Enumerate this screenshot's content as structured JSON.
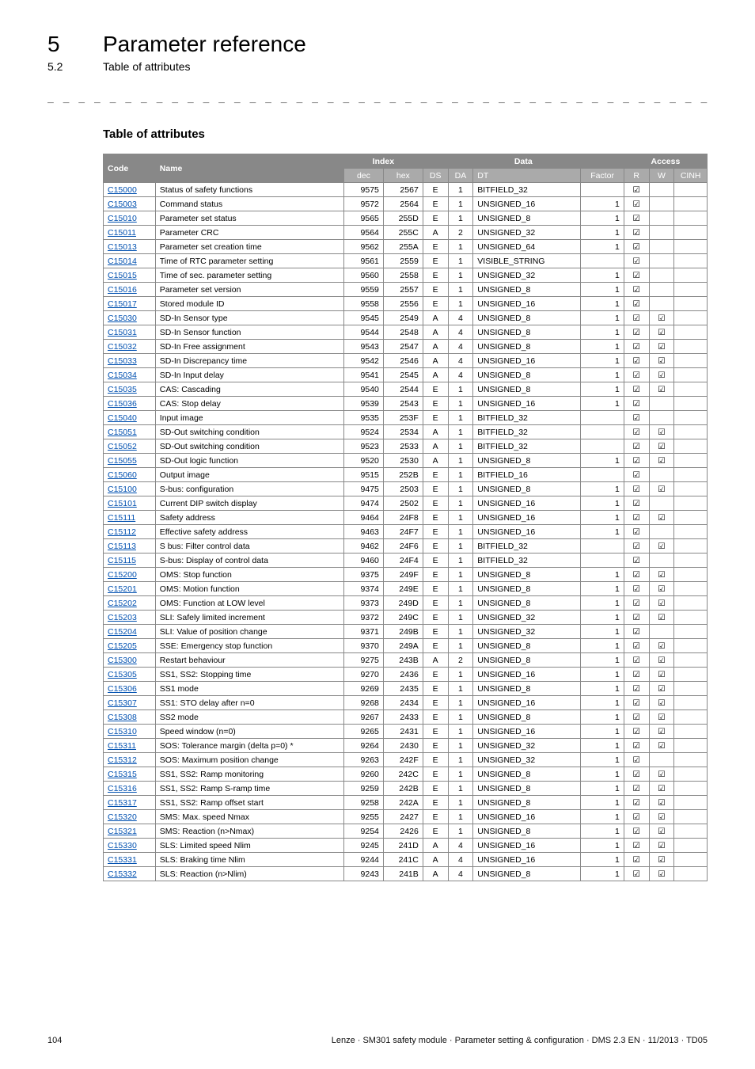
{
  "header": {
    "num": "5",
    "title": "Parameter reference",
    "sub_num": "5.2",
    "sub_title": "Table of attributes"
  },
  "dashes": "_ _ _ _ _ _ _ _ _ _ _ _ _ _ _ _ _ _ _ _ _ _ _ _ _ _ _ _ _ _ _ _ _ _ _ _ _ _ _ _ _ _ _ _ _ _ _ _ _ _ _ _ _ _ _ _ _ _ _ _ _ _ _",
  "section_title": "Table of attributes",
  "table": {
    "headers1": {
      "code": "Code",
      "name": "Name",
      "index": "Index",
      "data": "Data",
      "access": "Access"
    },
    "headers2": {
      "dec": "dec",
      "hex": "hex",
      "ds": "DS",
      "da": "DA",
      "dt": "DT",
      "factor": "Factor",
      "r": "R",
      "w": "W",
      "cinh": "CINH"
    },
    "rows": [
      {
        "code": "C15000",
        "name": "Status of safety functions",
        "dec": "9575",
        "hex": "2567",
        "ds": "E",
        "da": "1",
        "dt": "BITFIELD_32",
        "factor": "",
        "r": true,
        "w": false,
        "cinh": false
      },
      {
        "code": "C15003",
        "name": "Command status",
        "dec": "9572",
        "hex": "2564",
        "ds": "E",
        "da": "1",
        "dt": "UNSIGNED_16",
        "factor": "1",
        "r": true,
        "w": false,
        "cinh": false
      },
      {
        "code": "C15010",
        "name": "Parameter set status",
        "dec": "9565",
        "hex": "255D",
        "ds": "E",
        "da": "1",
        "dt": "UNSIGNED_8",
        "factor": "1",
        "r": true,
        "w": false,
        "cinh": false
      },
      {
        "code": "C15011",
        "name": "Parameter CRC",
        "dec": "9564",
        "hex": "255C",
        "ds": "A",
        "da": "2",
        "dt": "UNSIGNED_32",
        "factor": "1",
        "r": true,
        "w": false,
        "cinh": false
      },
      {
        "code": "C15013",
        "name": "Parameter set creation time",
        "dec": "9562",
        "hex": "255A",
        "ds": "E",
        "da": "1",
        "dt": "UNSIGNED_64",
        "factor": "1",
        "r": true,
        "w": false,
        "cinh": false
      },
      {
        "code": "C15014",
        "name": "Time of RTC parameter setting",
        "dec": "9561",
        "hex": "2559",
        "ds": "E",
        "da": "1",
        "dt": "VISIBLE_STRING",
        "factor": "",
        "r": true,
        "w": false,
        "cinh": false
      },
      {
        "code": "C15015",
        "name": "Time of sec. parameter setting",
        "dec": "9560",
        "hex": "2558",
        "ds": "E",
        "da": "1",
        "dt": "UNSIGNED_32",
        "factor": "1",
        "r": true,
        "w": false,
        "cinh": false
      },
      {
        "code": "C15016",
        "name": "Parameter set version",
        "dec": "9559",
        "hex": "2557",
        "ds": "E",
        "da": "1",
        "dt": "UNSIGNED_8",
        "factor": "1",
        "r": true,
        "w": false,
        "cinh": false
      },
      {
        "code": "C15017",
        "name": "Stored module ID",
        "dec": "9558",
        "hex": "2556",
        "ds": "E",
        "da": "1",
        "dt": "UNSIGNED_16",
        "factor": "1",
        "r": true,
        "w": false,
        "cinh": false
      },
      {
        "code": "C15030",
        "name": "SD-In Sensor type",
        "dec": "9545",
        "hex": "2549",
        "ds": "A",
        "da": "4",
        "dt": "UNSIGNED_8",
        "factor": "1",
        "r": true,
        "w": true,
        "cinh": false
      },
      {
        "code": "C15031",
        "name": "SD-In Sensor function",
        "dec": "9544",
        "hex": "2548",
        "ds": "A",
        "da": "4",
        "dt": "UNSIGNED_8",
        "factor": "1",
        "r": true,
        "w": true,
        "cinh": false
      },
      {
        "code": "C15032",
        "name": "SD-In Free assignment",
        "dec": "9543",
        "hex": "2547",
        "ds": "A",
        "da": "4",
        "dt": "UNSIGNED_8",
        "factor": "1",
        "r": true,
        "w": true,
        "cinh": false
      },
      {
        "code": "C15033",
        "name": "SD-In Discrepancy time",
        "dec": "9542",
        "hex": "2546",
        "ds": "A",
        "da": "4",
        "dt": "UNSIGNED_16",
        "factor": "1",
        "r": true,
        "w": true,
        "cinh": false
      },
      {
        "code": "C15034",
        "name": "SD-In Input delay",
        "dec": "9541",
        "hex": "2545",
        "ds": "A",
        "da": "4",
        "dt": "UNSIGNED_8",
        "factor": "1",
        "r": true,
        "w": true,
        "cinh": false
      },
      {
        "code": "C15035",
        "name": "CAS: Cascading",
        "dec": "9540",
        "hex": "2544",
        "ds": "E",
        "da": "1",
        "dt": "UNSIGNED_8",
        "factor": "1",
        "r": true,
        "w": true,
        "cinh": false
      },
      {
        "code": "C15036",
        "name": "CAS: Stop delay",
        "dec": "9539",
        "hex": "2543",
        "ds": "E",
        "da": "1",
        "dt": "UNSIGNED_16",
        "factor": "1",
        "r": true,
        "w": false,
        "cinh": false
      },
      {
        "code": "C15040",
        "name": "Input image",
        "dec": "9535",
        "hex": "253F",
        "ds": "E",
        "da": "1",
        "dt": "BITFIELD_32",
        "factor": "",
        "r": true,
        "w": false,
        "cinh": false
      },
      {
        "code": "C15051",
        "name": "SD-Out switching condition",
        "dec": "9524",
        "hex": "2534",
        "ds": "A",
        "da": "1",
        "dt": "BITFIELD_32",
        "factor": "",
        "r": true,
        "w": true,
        "cinh": false
      },
      {
        "code": "C15052",
        "name": "SD-Out switching condition",
        "dec": "9523",
        "hex": "2533",
        "ds": "A",
        "da": "1",
        "dt": "BITFIELD_32",
        "factor": "",
        "r": true,
        "w": true,
        "cinh": false
      },
      {
        "code": "C15055",
        "name": "SD-Out logic function",
        "dec": "9520",
        "hex": "2530",
        "ds": "A",
        "da": "1",
        "dt": "UNSIGNED_8",
        "factor": "1",
        "r": true,
        "w": true,
        "cinh": false
      },
      {
        "code": "C15060",
        "name": "Output image",
        "dec": "9515",
        "hex": "252B",
        "ds": "E",
        "da": "1",
        "dt": "BITFIELD_16",
        "factor": "",
        "r": true,
        "w": false,
        "cinh": false
      },
      {
        "code": "C15100",
        "name": "S-bus: configuration",
        "dec": "9475",
        "hex": "2503",
        "ds": "E",
        "da": "1",
        "dt": "UNSIGNED_8",
        "factor": "1",
        "r": true,
        "w": true,
        "cinh": false
      },
      {
        "code": "C15101",
        "name": "Current DIP switch display",
        "dec": "9474",
        "hex": "2502",
        "ds": "E",
        "da": "1",
        "dt": "UNSIGNED_16",
        "factor": "1",
        "r": true,
        "w": false,
        "cinh": false
      },
      {
        "code": "C15111",
        "name": "Safety address",
        "dec": "9464",
        "hex": "24F8",
        "ds": "E",
        "da": "1",
        "dt": "UNSIGNED_16",
        "factor": "1",
        "r": true,
        "w": true,
        "cinh": false
      },
      {
        "code": "C15112",
        "name": "Effective safety address",
        "dec": "9463",
        "hex": "24F7",
        "ds": "E",
        "da": "1",
        "dt": "UNSIGNED_16",
        "factor": "1",
        "r": true,
        "w": false,
        "cinh": false
      },
      {
        "code": "C15113",
        "name": "S bus: Filter control data",
        "dec": "9462",
        "hex": "24F6",
        "ds": "E",
        "da": "1",
        "dt": "BITFIELD_32",
        "factor": "",
        "r": true,
        "w": true,
        "cinh": false
      },
      {
        "code": "C15115",
        "name": "S-bus: Display of control data",
        "dec": "9460",
        "hex": "24F4",
        "ds": "E",
        "da": "1",
        "dt": "BITFIELD_32",
        "factor": "",
        "r": true,
        "w": false,
        "cinh": false
      },
      {
        "code": "C15200",
        "name": "OMS: Stop function",
        "dec": "9375",
        "hex": "249F",
        "ds": "E",
        "da": "1",
        "dt": "UNSIGNED_8",
        "factor": "1",
        "r": true,
        "w": true,
        "cinh": false
      },
      {
        "code": "C15201",
        "name": "OMS: Motion function",
        "dec": "9374",
        "hex": "249E",
        "ds": "E",
        "da": "1",
        "dt": "UNSIGNED_8",
        "factor": "1",
        "r": true,
        "w": true,
        "cinh": false
      },
      {
        "code": "C15202",
        "name": "OMS: Function at LOW level",
        "dec": "9373",
        "hex": "249D",
        "ds": "E",
        "da": "1",
        "dt": "UNSIGNED_8",
        "factor": "1",
        "r": true,
        "w": true,
        "cinh": false
      },
      {
        "code": "C15203",
        "name": "SLI: Safely limited increment",
        "dec": "9372",
        "hex": "249C",
        "ds": "E",
        "da": "1",
        "dt": "UNSIGNED_32",
        "factor": "1",
        "r": true,
        "w": true,
        "cinh": false
      },
      {
        "code": "C15204",
        "name": "SLI: Value of position change",
        "dec": "9371",
        "hex": "249B",
        "ds": "E",
        "da": "1",
        "dt": "UNSIGNED_32",
        "factor": "1",
        "r": true,
        "w": false,
        "cinh": false
      },
      {
        "code": "C15205",
        "name": "SSE: Emergency stop function",
        "dec": "9370",
        "hex": "249A",
        "ds": "E",
        "da": "1",
        "dt": "UNSIGNED_8",
        "factor": "1",
        "r": true,
        "w": true,
        "cinh": false
      },
      {
        "code": "C15300",
        "name": "Restart behaviour",
        "dec": "9275",
        "hex": "243B",
        "ds": "A",
        "da": "2",
        "dt": "UNSIGNED_8",
        "factor": "1",
        "r": true,
        "w": true,
        "cinh": false
      },
      {
        "code": "C15305",
        "name": "SS1, SS2: Stopping time",
        "dec": "9270",
        "hex": "2436",
        "ds": "E",
        "da": "1",
        "dt": "UNSIGNED_16",
        "factor": "1",
        "r": true,
        "w": true,
        "cinh": false
      },
      {
        "code": "C15306",
        "name": "SS1 mode",
        "dec": "9269",
        "hex": "2435",
        "ds": "E",
        "da": "1",
        "dt": "UNSIGNED_8",
        "factor": "1",
        "r": true,
        "w": true,
        "cinh": false
      },
      {
        "code": "C15307",
        "name": "SS1: STO delay after n=0",
        "dec": "9268",
        "hex": "2434",
        "ds": "E",
        "da": "1",
        "dt": "UNSIGNED_16",
        "factor": "1",
        "r": true,
        "w": true,
        "cinh": false
      },
      {
        "code": "C15308",
        "name": "SS2 mode",
        "dec": "9267",
        "hex": "2433",
        "ds": "E",
        "da": "1",
        "dt": "UNSIGNED_8",
        "factor": "1",
        "r": true,
        "w": true,
        "cinh": false
      },
      {
        "code": "C15310",
        "name": "Speed window (n=0)",
        "dec": "9265",
        "hex": "2431",
        "ds": "E",
        "da": "1",
        "dt": "UNSIGNED_16",
        "factor": "1",
        "r": true,
        "w": true,
        "cinh": false
      },
      {
        "code": "C15311",
        "name": "SOS: Tolerance margin (delta p=0) *",
        "dec": "9264",
        "hex": "2430",
        "ds": "E",
        "da": "1",
        "dt": "UNSIGNED_32",
        "factor": "1",
        "r": true,
        "w": true,
        "cinh": false
      },
      {
        "code": "C15312",
        "name": "SOS: Maximum position change",
        "dec": "9263",
        "hex": "242F",
        "ds": "E",
        "da": "1",
        "dt": "UNSIGNED_32",
        "factor": "1",
        "r": true,
        "w": false,
        "cinh": false
      },
      {
        "code": "C15315",
        "name": "SS1, SS2: Ramp monitoring",
        "dec": "9260",
        "hex": "242C",
        "ds": "E",
        "da": "1",
        "dt": "UNSIGNED_8",
        "factor": "1",
        "r": true,
        "w": true,
        "cinh": false
      },
      {
        "code": "C15316",
        "name": "SS1, SS2: Ramp S-ramp time",
        "dec": "9259",
        "hex": "242B",
        "ds": "E",
        "da": "1",
        "dt": "UNSIGNED_8",
        "factor": "1",
        "r": true,
        "w": true,
        "cinh": false
      },
      {
        "code": "C15317",
        "name": "SS1, SS2: Ramp offset start",
        "dec": "9258",
        "hex": "242A",
        "ds": "E",
        "da": "1",
        "dt": "UNSIGNED_8",
        "factor": "1",
        "r": true,
        "w": true,
        "cinh": false
      },
      {
        "code": "C15320",
        "name": "SMS: Max. speed Nmax",
        "dec": "9255",
        "hex": "2427",
        "ds": "E",
        "da": "1",
        "dt": "UNSIGNED_16",
        "factor": "1",
        "r": true,
        "w": true,
        "cinh": false
      },
      {
        "code": "C15321",
        "name": "SMS: Reaction (n>Nmax)",
        "dec": "9254",
        "hex": "2426",
        "ds": "E",
        "da": "1",
        "dt": "UNSIGNED_8",
        "factor": "1",
        "r": true,
        "w": true,
        "cinh": false
      },
      {
        "code": "C15330",
        "name": "SLS: Limited speed Nlim",
        "dec": "9245",
        "hex": "241D",
        "ds": "A",
        "da": "4",
        "dt": "UNSIGNED_16",
        "factor": "1",
        "r": true,
        "w": true,
        "cinh": false
      },
      {
        "code": "C15331",
        "name": "SLS: Braking time Nlim",
        "dec": "9244",
        "hex": "241C",
        "ds": "A",
        "da": "4",
        "dt": "UNSIGNED_16",
        "factor": "1",
        "r": true,
        "w": true,
        "cinh": false
      },
      {
        "code": "C15332",
        "name": "SLS: Reaction (n>Nlim)",
        "dec": "9243",
        "hex": "241B",
        "ds": "A",
        "da": "4",
        "dt": "UNSIGNED_8",
        "factor": "1",
        "r": true,
        "w": true,
        "cinh": false
      }
    ]
  },
  "check": "☑",
  "footer": {
    "page": "104",
    "text": "Lenze · SM301 safety module · Parameter setting & configuration · DMS 2.3 EN · 11/2013 · TD05"
  }
}
